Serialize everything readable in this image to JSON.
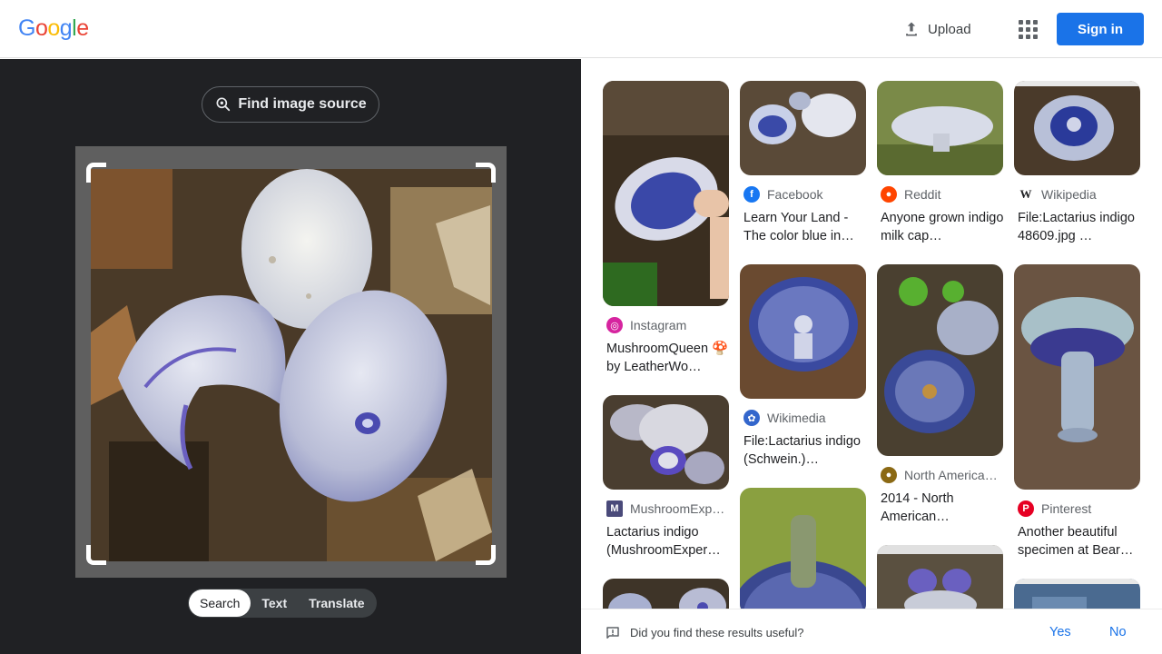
{
  "header": {
    "logo_letters": [
      "G",
      "o",
      "o",
      "g",
      "l",
      "e"
    ],
    "upload_label": "Upload",
    "apps_icon": "apps-grid-icon",
    "signin_label": "Sign in"
  },
  "left": {
    "find_source_label": "Find image source",
    "tabs": [
      {
        "label": "Search",
        "active": true
      },
      {
        "label": "Text",
        "active": false
      },
      {
        "label": "Translate",
        "active": false
      }
    ]
  },
  "results": [
    {
      "source": "Instagram",
      "title": "MushroomQueen 🍄 by LeatherWo…",
      "icon_color": "#d6249f",
      "icon_glyph": "◎"
    },
    {
      "source": "MushroomExp…",
      "title": "Lactarius indigo (MushroomExper…",
      "icon_color": "#4a4a7a",
      "icon_glyph": "M"
    },
    {
      "source": "Facebook",
      "title": "Learn Your Land - The color blue in…",
      "icon_color": "#1877f2",
      "icon_glyph": "f"
    },
    {
      "source": "Wikimedia",
      "title": "File:Lactarius indigo (Schwein.)…",
      "icon_color": "#3366cc",
      "icon_glyph": "✿"
    },
    {
      "source": "Reddit",
      "title": "Anyone grown indigo milk cap…",
      "icon_color": "#ff4500",
      "icon_glyph": "●"
    },
    {
      "source": "North America…",
      "title": "2014 - North American…",
      "icon_color": "#8b6914",
      "icon_glyph": "●"
    },
    {
      "source": "Wikipedia",
      "title": "File:Lactarius indigo 48609.jpg …",
      "icon_color": "#ffffff",
      "icon_glyph": "W"
    },
    {
      "source": "Pinterest",
      "title": "Another beautiful specimen at Bear…",
      "icon_color": "#e60023",
      "icon_glyph": "P"
    }
  ],
  "feedback": {
    "question": "Did you find these results useful?",
    "yes_label": "Yes",
    "no_label": "No"
  }
}
